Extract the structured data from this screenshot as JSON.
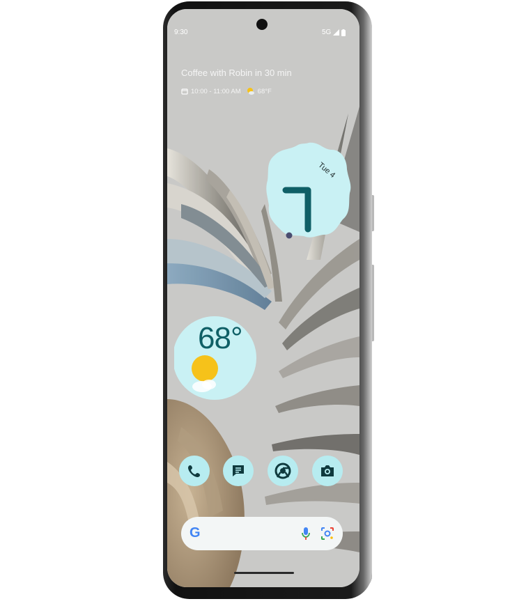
{
  "status_bar": {
    "time": "9:30",
    "network": "5G"
  },
  "at_a_glance": {
    "event": "Coffee with Robin in 30 min",
    "event_time": "10:00 - 11:00 AM",
    "temperature": "68°F",
    "calendar_icon": "calendar-icon",
    "weather_icon": "partly-sunny-icon"
  },
  "clock_widget": {
    "date": "Tue 4",
    "hour": "7"
  },
  "weather_widget": {
    "temperature": "68°",
    "icon": "sun-cloud-icon"
  },
  "dock": [
    {
      "name": "phone",
      "icon": "phone-icon"
    },
    {
      "name": "messages",
      "icon": "messages-icon"
    },
    {
      "name": "chrome",
      "icon": "chrome-icon"
    },
    {
      "name": "camera",
      "icon": "camera-icon"
    }
  ],
  "search_bar": {
    "logo": "G",
    "mic_icon": "mic-icon",
    "lens_icon": "lens-icon"
  },
  "colors": {
    "widget_bg": "#c9f1f4",
    "accent_dark": "#0f5f66",
    "dock_bg": "#b7ecf0",
    "sun": "#f6c21a"
  }
}
